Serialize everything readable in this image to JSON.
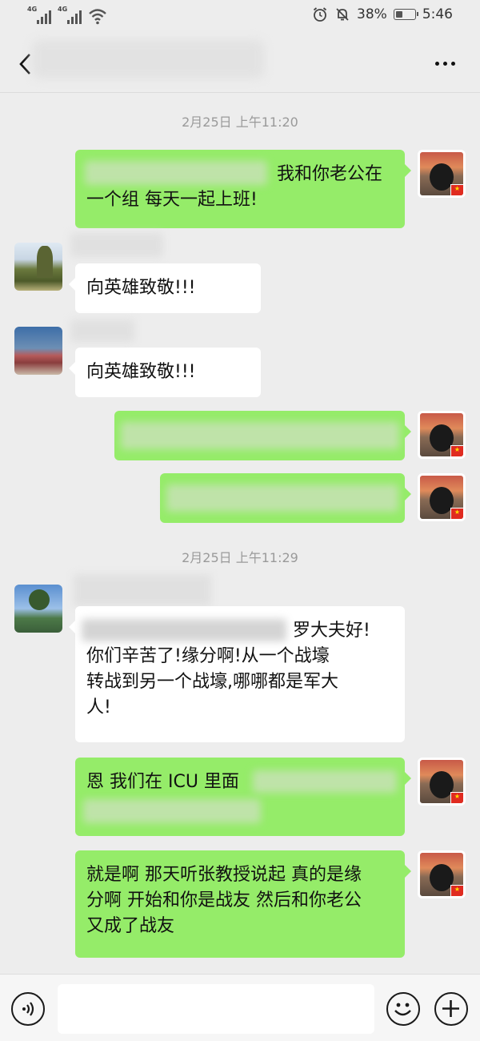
{
  "status_bar": {
    "network_1": "4G",
    "network_2": "4G",
    "battery": "38%",
    "battery_level": 0.38,
    "time": "5:46"
  },
  "header": {
    "back_icon": "chevron-left-icon",
    "more_icon": "more-dots-icon"
  },
  "chat": {
    "timestamp_1": "2月25日 上午11:20",
    "msg1_line1": "我和你老公在",
    "msg1_line2": "一个组 每天一起上班!",
    "msg2": "向英雄致敬!!!",
    "msg3": "向英雄致敬!!!",
    "timestamp_2": "2月25日 上午11:29",
    "msg6_line1": "罗大夫好!",
    "msg6_line2": "你们辛苦了!缘分啊!从一个战壕",
    "msg6_line3": "转战到另一个战壕,哪哪都是军大",
    "msg6_line4": "人!",
    "msg7_line1": "恩 我们在 ICU 里面",
    "msg8_line1": "就是啊 那天听张教授说起 真的是缘",
    "msg8_line2": "分啊 开始和你是战友 然后和你老公",
    "msg8_line3": "又成了战友"
  },
  "input_bar": {
    "voice_icon": "voice-icon",
    "emoji_icon": "emoji-icon",
    "plus_icon": "plus-icon"
  },
  "colors": {
    "background": "#ededed",
    "outgoing_bubble": "#95ec69",
    "incoming_bubble": "#ffffff",
    "timestamp": "#9a9a9a"
  }
}
